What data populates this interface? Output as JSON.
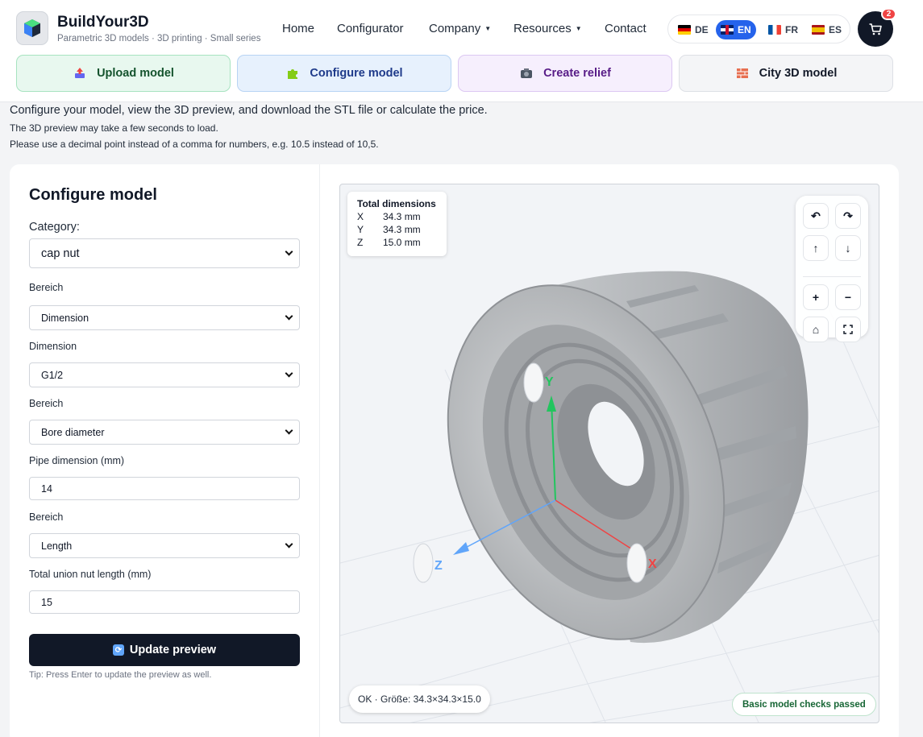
{
  "brand": {
    "title": "BuildYour3D",
    "subtitle": "Parametric 3D models · 3D printing · Small series"
  },
  "nav": {
    "home": "Home",
    "configurator": "Configurator",
    "company": "Company",
    "resources": "Resources",
    "contact": "Contact"
  },
  "languages": [
    {
      "code": "DE",
      "active": false
    },
    {
      "code": "EN",
      "active": true
    },
    {
      "code": "FR",
      "active": false
    },
    {
      "code": "ES",
      "active": false
    }
  ],
  "cart": {
    "count": "2"
  },
  "tools": {
    "upload": "Upload model",
    "configure": "Configure model",
    "relief": "Create relief",
    "city": "City 3D model"
  },
  "intro": {
    "line1": "Configure your model, view the 3D preview, and download the STL file or calculate the price.",
    "line2": "The 3D preview may take a few seconds to load.",
    "line3": "Please use a decimal point instead of a comma for numbers, e.g. 10.5 instead of 10,5."
  },
  "form": {
    "title": "Configure model",
    "category_label": "Category:",
    "category_value": "cap nut",
    "section1_label": "Bereich",
    "section1_value": "Dimension",
    "dimension_label": "Dimension",
    "dimension_value": "G1/2",
    "section2_label": "Bereich",
    "section2_value": "Bore diameter",
    "pipe_label": "Pipe dimension (mm)",
    "pipe_value": "14",
    "section3_label": "Bereich",
    "section3_value": "Length",
    "length_label": "Total union nut length (mm)",
    "length_value": "15",
    "update_button": "Update preview",
    "tip": "Tip: Press Enter to update the preview as well."
  },
  "viewer": {
    "dims_title": "Total dimensions",
    "dims": [
      {
        "axis": "X",
        "value": "34.3 mm"
      },
      {
        "axis": "Y",
        "value": "34.3 mm"
      },
      {
        "axis": "Z",
        "value": "15.0 mm"
      }
    ],
    "axis_labels": {
      "x": "X",
      "y": "Y",
      "z": "Z"
    },
    "status": "OK · Größe: 34.3×34.3×15.0",
    "checks": "Basic model checks passed",
    "colors": {
      "x_axis": "#ef4444",
      "y_axis": "#22c55e",
      "z_axis": "#60a5fa",
      "model": "#b9bcbf"
    },
    "controls": [
      "rotate-left-icon",
      "rotate-right-icon",
      "arrow-up-icon",
      "arrow-down-icon",
      "zoom-in-icon",
      "zoom-out-icon",
      "home-icon",
      "fullscreen-icon"
    ]
  }
}
